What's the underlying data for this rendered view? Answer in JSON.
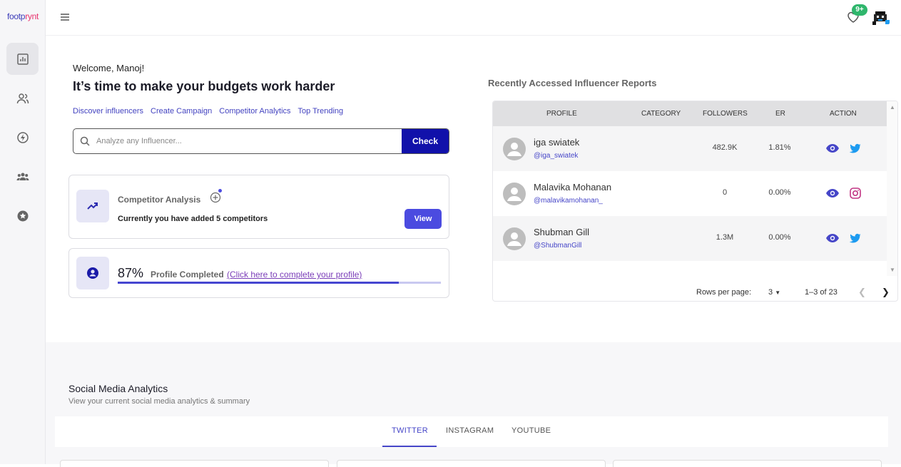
{
  "brand": {
    "logo_part1": "footp",
    "logo_part2": "rynt"
  },
  "topbar": {
    "notification_count": "9+"
  },
  "welcome": {
    "greeting": "Welcome, Manoj!",
    "headline": "It’s time to make your budgets work harder",
    "links": [
      "Discover influencers",
      "Create Campaign",
      "Competitor Analytics",
      "Top Trending"
    ]
  },
  "search": {
    "placeholder": "Analyze any Influencer...",
    "button": "Check"
  },
  "competitor": {
    "title": "Competitor Analysis",
    "subtitle": "Currently you have added 5 competitors",
    "button": "View"
  },
  "profile": {
    "percent": "87%",
    "percent_value": 0.87,
    "label": "Profile Completed",
    "link": "(Click here to complete your profile)"
  },
  "reports": {
    "title": "Recently Accessed Influencer Reports",
    "columns": [
      "PROFILE",
      "CATEGORY",
      "FOLLOWERS",
      "ER",
      "ACTION"
    ],
    "rows": [
      {
        "name": "iga swiatek",
        "handle": "@iga_swiatek",
        "category": "",
        "followers": "482.9K",
        "er": "1.81%",
        "social": "twitter"
      },
      {
        "name": "Malavika Mohanan",
        "handle": "@malavikamohanan_",
        "category": "",
        "followers": "0",
        "er": "0.00%",
        "social": "instagram"
      },
      {
        "name": "Shubman Gill",
        "handle": "@ShubmanGill",
        "category": "",
        "followers": "1.3M",
        "er": "0.00%",
        "social": "twitter"
      }
    ],
    "pager": {
      "rows_label": "Rows per page:",
      "rows_value": "3",
      "range": "1–3 of 23"
    }
  },
  "social": {
    "title": "Social Media Analytics",
    "subtitle": "View your current social media analytics & summary",
    "tabs": [
      "TWITTER",
      "INSTAGRAM",
      "YOUTUBE"
    ],
    "active_tab": "TWITTER"
  },
  "colors": {
    "accent": "#4646c8",
    "check_button": "#1111aa",
    "badge": "#2fb66c",
    "instagram": "#c13584",
    "twitter": "#1d9bf0"
  }
}
